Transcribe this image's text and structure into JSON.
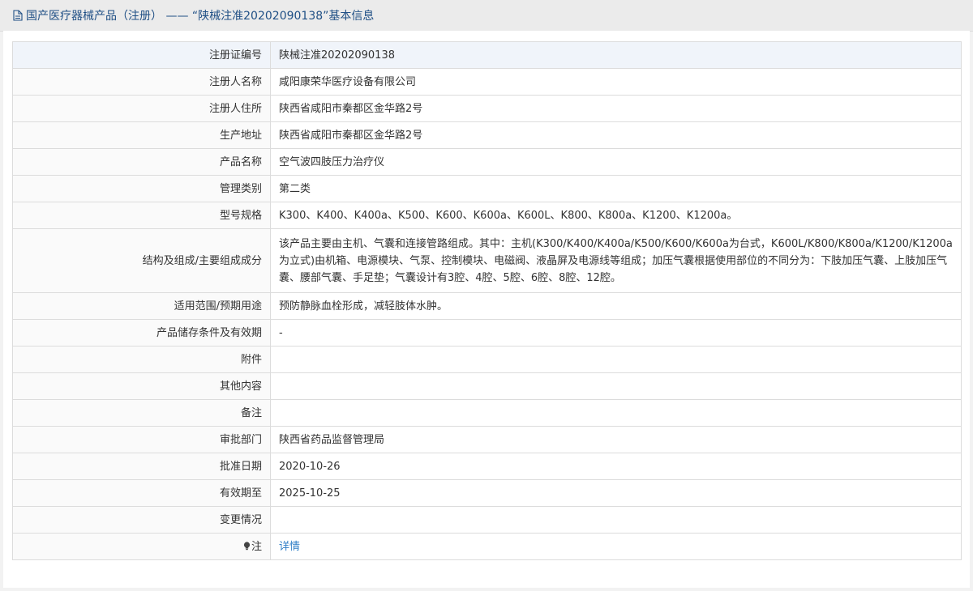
{
  "header": {
    "icon": "document-icon",
    "title": "国产医疗器械产品（注册） —— “陕械注准20202090138”基本信息"
  },
  "rows": [
    {
      "label": "注册证编号",
      "value": "陕械注准20202090138"
    },
    {
      "label": "注册人名称",
      "value": "咸阳康荣华医疗设备有限公司"
    },
    {
      "label": "注册人住所",
      "value": "陕西省咸阳市秦都区金华路2号"
    },
    {
      "label": "生产地址",
      "value": "陕西省咸阳市秦都区金华路2号"
    },
    {
      "label": "产品名称",
      "value": "空气波四肢压力治疗仪"
    },
    {
      "label": "管理类别",
      "value": "第二类"
    },
    {
      "label": "型号规格",
      "value": "K300、K400、K400a、K500、K600、K600a、K600L、K800、K800a、K1200、K1200a。"
    },
    {
      "label": "结构及组成/主要组成成分",
      "value": "该产品主要由主机、气囊和连接管路组成。其中：主机(K300/K400/K400a/K500/K600/K600a为台式，K600L/K800/K800a/K1200/K1200a为立式)由机箱、电源模块、气泵、控制模块、电磁阀、液晶屏及电源线等组成；加压气囊根据使用部位的不同分为：下肢加压气囊、上肢加压气囊、腰部气囊、手足垫；气囊设计有3腔、4腔、5腔、6腔、8腔、12腔。"
    },
    {
      "label": "适用范围/预期用途",
      "value": "预防静脉血栓形成，减轻肢体水肿。"
    },
    {
      "label": "产品储存条件及有效期",
      "value": "-"
    },
    {
      "label": "附件",
      "value": ""
    },
    {
      "label": "其他内容",
      "value": ""
    },
    {
      "label": "备注",
      "value": ""
    },
    {
      "label": "审批部门",
      "value": "陕西省药品监督管理局"
    },
    {
      "label": "批准日期",
      "value": "2020-10-26"
    },
    {
      "label": "有效期至",
      "value": "2025-10-25"
    },
    {
      "label": "变更情况",
      "value": ""
    }
  ],
  "note": {
    "icon": "lightbulb-icon",
    "label": "注",
    "link_text": "详情"
  }
}
